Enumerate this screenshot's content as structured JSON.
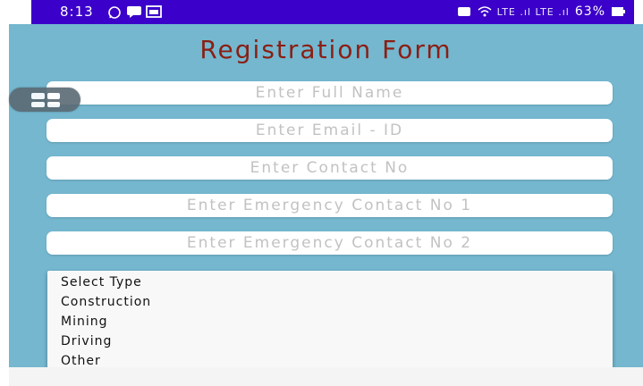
{
  "status_bar": {
    "time": "8:13",
    "battery_text": "63%",
    "network_text": "LTE .ıl LTE .ıl"
  },
  "form": {
    "title": "Registration Form",
    "fields": [
      {
        "placeholder": "Enter Full Name",
        "value": ""
      },
      {
        "placeholder": "Enter Email - ID",
        "value": ""
      },
      {
        "placeholder": "Enter Contact No",
        "value": ""
      },
      {
        "placeholder": "Enter Emergency Contact No 1",
        "value": ""
      },
      {
        "placeholder": "Enter Emergency Contact No 2",
        "value": ""
      }
    ]
  },
  "dropdown": {
    "options": [
      "Select Type",
      "Construction",
      "Mining",
      "Driving",
      "Other"
    ]
  },
  "colors": {
    "status_bar": "#3b00c9",
    "background": "#74b7cf",
    "title": "#8b1e12"
  },
  "icons": {
    "floating_button": "grid-icon"
  }
}
